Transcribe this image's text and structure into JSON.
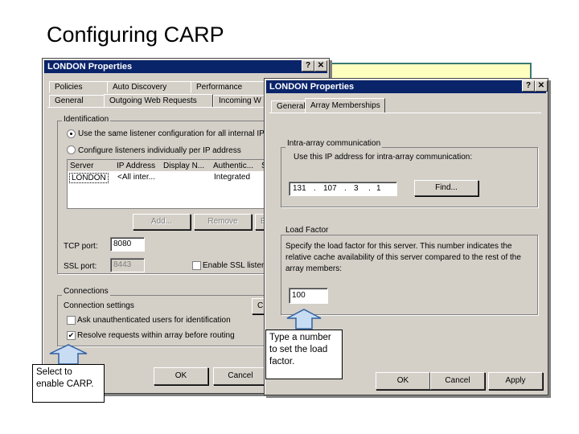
{
  "slide": {
    "title": "Configuring CARP"
  },
  "dialog1": {
    "title": "LONDON Properties",
    "help_btn": "?",
    "close_btn": "✕",
    "tabs_row1": [
      "Policies",
      "Auto Discovery",
      "Performance"
    ],
    "tabs_row2": [
      "General",
      "Outgoing Web Requests",
      "Incoming W"
    ],
    "identification_label": "Identification",
    "radio_same": "Use the same listener configuration for all internal IP a",
    "radio_individual": "Configure listeners individually per IP address",
    "table_headers": [
      "Server",
      "IP Address",
      "Display N...",
      "Authentic...",
      "S"
    ],
    "table_row": [
      "LONDON",
      "<All inter...",
      "",
      "Integrated"
    ],
    "add_btn": "Add...",
    "remove_btn": "Remove",
    "edit_btn": "E",
    "tcp_port_label": "TCP port:",
    "tcp_port_value": "8080",
    "ssl_port_label": "SSL port:",
    "ssl_port_value": "8443",
    "enable_ssl": "Enable SSL listen",
    "connections_label": "Connections",
    "connection_settings": "Connection settings",
    "connection_btn": "C",
    "ask_unauth": "Ask unauthenticated users for identification",
    "resolve_requests": "Resolve requests within array before routing",
    "ok_btn": "OK",
    "cancel_btn": "Cancel",
    "check_mark": "✔"
  },
  "dialog2": {
    "title": "LONDON Properties",
    "help_btn": "?",
    "close_btn": "✕",
    "tabs": [
      "General",
      "Array Memberships"
    ],
    "intra_label": "Intra-array communication",
    "intra_desc": "Use this IP address for intra-array communication:",
    "ip_octets": [
      "131",
      "107",
      "3",
      "1"
    ],
    "ip_dot": ".",
    "find_btn": "Find...",
    "load_factor_label": "Load Factor",
    "load_desc": "Specify the load factor for this server. This number indicates the relative cache availability of this server compared to the rest of the array members:",
    "load_value": "100",
    "ok_btn": "OK",
    "cancel_btn": "Cancel",
    "apply_btn": "Apply"
  },
  "callouts": {
    "left": "Select to enable CARP.",
    "right": "Type a number to set the load factor."
  },
  "colors": {
    "titlebar": "#0a246a",
    "dialog_face": "#d4d0c8",
    "arrow_fill": "#c8dcf4",
    "arrow_stroke": "#3060a0",
    "note_bg": "#ffffc0"
  }
}
